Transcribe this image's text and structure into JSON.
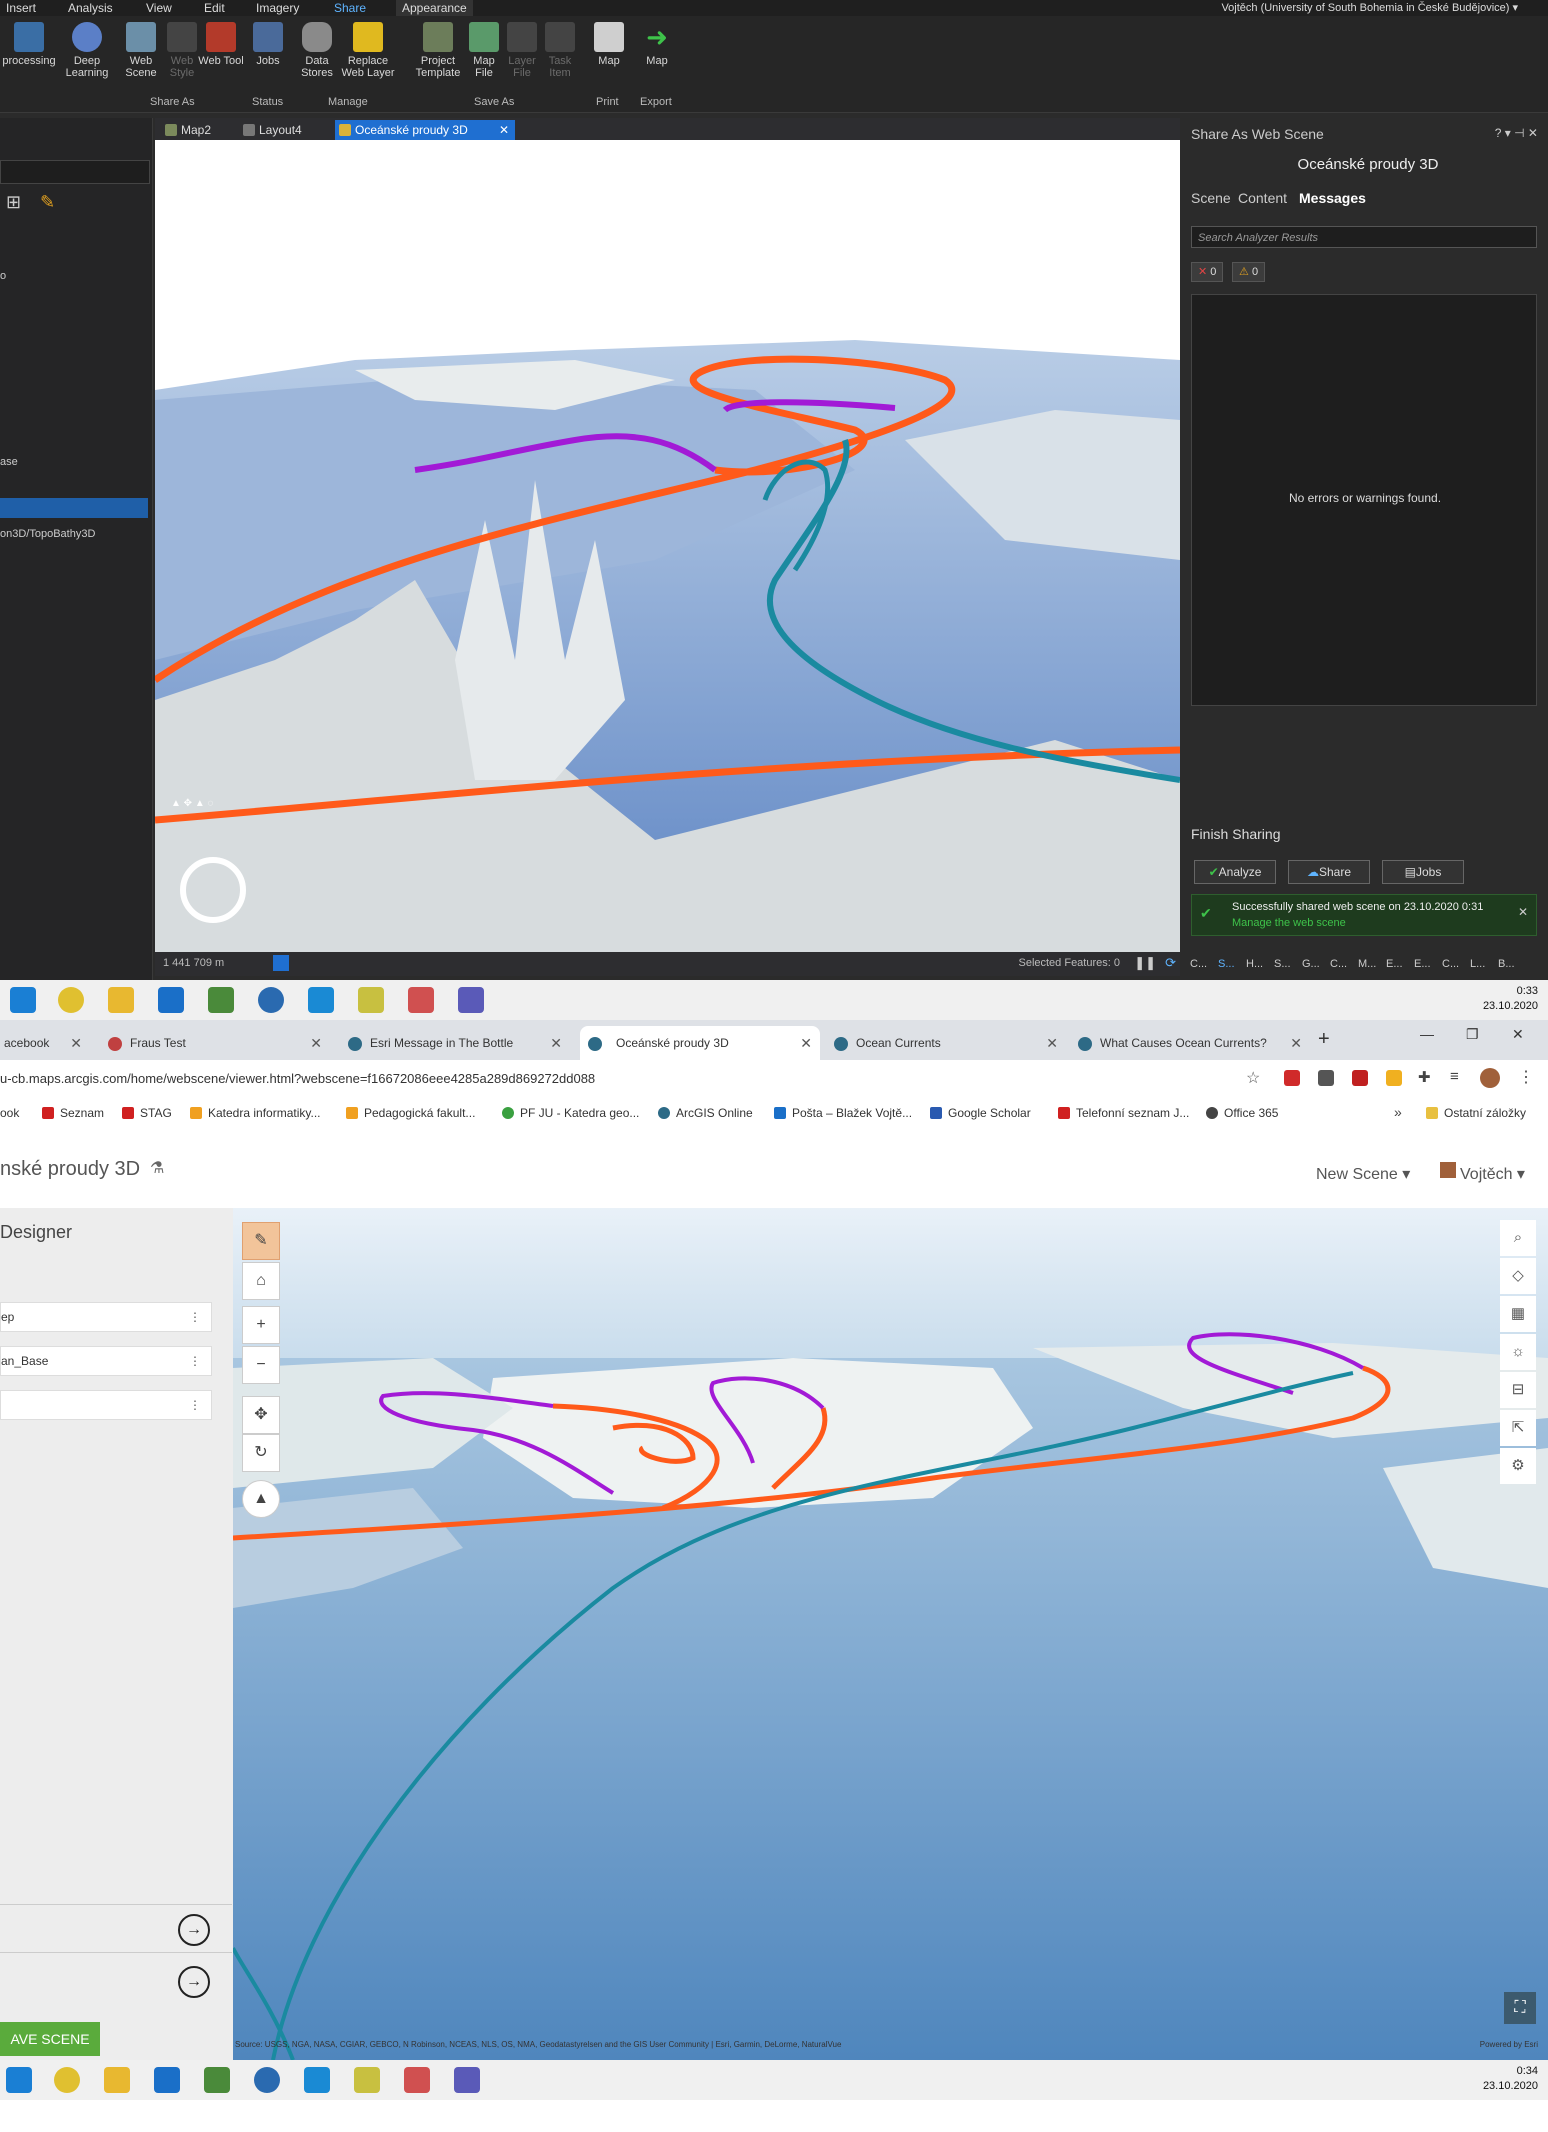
{
  "pro": {
    "menu_tabs": [
      "Insert",
      "Analysis",
      "View",
      "Edit",
      "Imagery",
      "Share",
      "Appearance"
    ],
    "active_tab": "Share",
    "user": "Vojtěch (University of South Bohemia in České Budějovice) ▾",
    "ribbon": {
      "geoprocessing": "processing",
      "deep_learning": "Deep Learning",
      "web_scene": "Web Scene",
      "web_style": "Web Style",
      "web_tool": "Web Tool",
      "jobs": "Jobs",
      "data_stores": "Data Stores",
      "replace_web_layer": "Replace Web Layer",
      "project_template": "Project Template",
      "map_file": "Map File",
      "layer_file": "Layer File",
      "task_item": "Task Item",
      "map_print": "Map",
      "map_export": "Map",
      "groups": [
        "Share As",
        "Status",
        "Manage",
        "Save As",
        "Print",
        "Export"
      ]
    },
    "left_pane": {
      "items": [
        "o",
        "ase",
        "on3D/TopoBathy3D"
      ]
    },
    "doc_tabs": [
      "Map2",
      "Layout4",
      "Oceánské proudy 3D"
    ],
    "status": {
      "scale": "1 441 709 m",
      "selected": "Selected Features: 0"
    },
    "share_pane": {
      "title": "Share As Web Scene",
      "subtitle": "Oceánské proudy 3D",
      "tabs": [
        "Scene",
        "Content",
        "Messages"
      ],
      "active_tab": "Messages",
      "search_placeholder": "Search Analyzer Results",
      "errors": "0",
      "warnings": "0",
      "no_messages": "No errors or warnings found.",
      "finish_label": "Finish Sharing",
      "analyze": "Analyze",
      "share": "Share",
      "jobs": "Jobs",
      "success_text": "Successfully shared web scene on 23.10.2020 0:31",
      "manage_link": "Manage the web scene",
      "bottom_tabs": [
        "C...",
        "S...",
        "H...",
        "S...",
        "G...",
        "C...",
        "M...",
        "E...",
        "E...",
        "C...",
        "L...",
        "B..."
      ]
    }
  },
  "taskbar_top": {
    "time": "0:33",
    "date": "23.10.2020"
  },
  "chrome": {
    "tabs": [
      "acebook",
      "Fraus Test",
      "Esri Message in The Bottle",
      "Oceánské proudy 3D",
      "Ocean Currents",
      "What Causes Ocean Currents?"
    ],
    "active_tab_index": 3,
    "url": "u-cb.maps.arcgis.com/home/webscene/viewer.html?webscene=f16672086eee4285a289d869272dd088",
    "bookmarks": [
      "ook",
      "Seznam",
      "STAG",
      "Katedra informatiky...",
      "Pedagogická fakult...",
      "PF JU - Katedra geo...",
      "ArcGIS Online",
      "Pošta – Blažek Vojtě...",
      "Google Scholar",
      "Telefonní seznam J...",
      "Office 365"
    ],
    "other_bookmarks": "Ostatní záložky"
  },
  "scene_viewer": {
    "title": "nské proudy 3D",
    "new_scene": "New Scene",
    "user": "Vojtěch",
    "designer": "Designer",
    "layers": [
      "ep",
      "an_Base",
      ""
    ],
    "save_button": "AVE SCENE",
    "attribution": "Source: USGS, NGA, NASA, CGIAR, GEBCO, N Robinson, NCEAS, NLS, OS, NMA, Geodatastyrelsen and the GIS User Community | Esri, Garmin, DeLorme, NaturalVue",
    "powered_by": "Powered by Esri"
  },
  "taskbar_bottom": {
    "time": "0:34",
    "date": "23.10.2020"
  },
  "colors": {
    "warm_current": "#ff5a1a",
    "cold_current": "#1a8aa0",
    "purple_current": "#a21ad6",
    "pro_accent": "#1f6fd1",
    "save_green": "#5aab3c"
  }
}
